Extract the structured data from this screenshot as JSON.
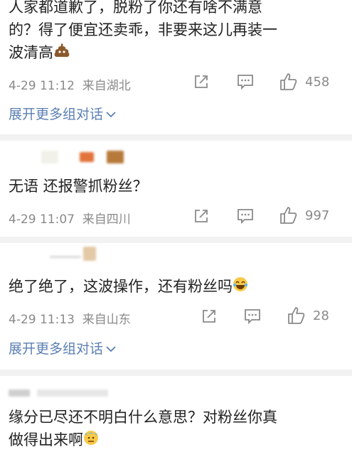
{
  "comments": [
    {
      "lines": [
        "人家都道歉了，脱粉了你还有啥不满意",
        "的？得了便宜还卖乖，非要来这儿再装一",
        "波清高"
      ],
      "time": "4-29 11:12",
      "location": "来自湖北",
      "likes": "458",
      "expand": "展开更多组对话",
      "emoji": "poop-emoji"
    },
    {
      "lines": [
        "无语 还报警抓粉丝？"
      ],
      "time": "4-29 11:07",
      "location": "来自四川",
      "likes": "997"
    },
    {
      "lines": [
        "绝了绝了，这波操作，还有粉丝吗"
      ],
      "time": "4-29 11:13",
      "location": "来自山东",
      "likes": "28",
      "expand": "展开更多组对话",
      "emoji": "laughing-emoji"
    },
    {
      "lines": [
        "缘分已尽还不明白什么意思？对粉丝你真",
        "做得出来啊"
      ],
      "emoji": "cold-sweat-emoji"
    }
  ],
  "colors": {
    "link": "#5b7fb3",
    "meta": "#8a8a8a",
    "separator": "#f2f2f2"
  },
  "icons": [
    "share-icon",
    "comment-icon",
    "like-icon",
    "chevron-down-icon"
  ]
}
